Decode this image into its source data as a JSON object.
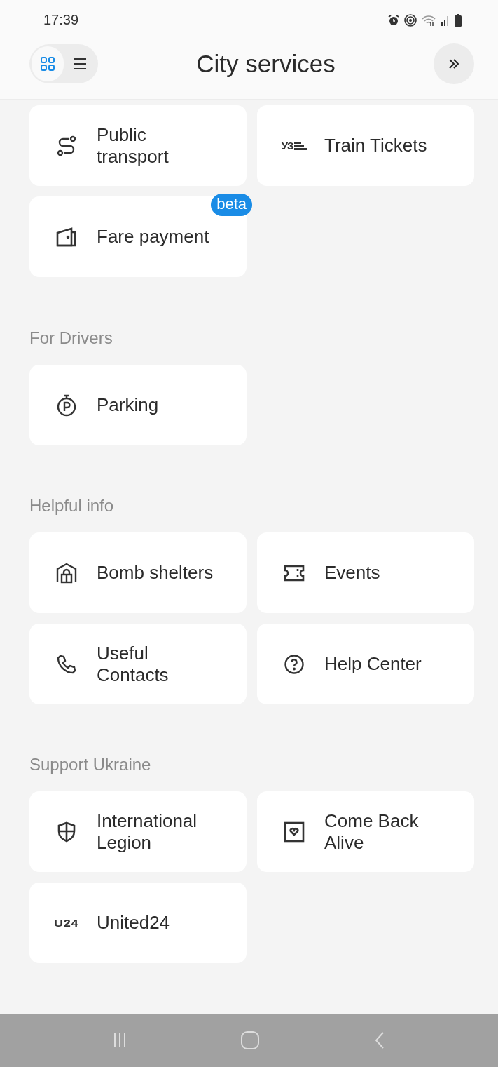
{
  "status_bar": {
    "time": "17:39"
  },
  "header": {
    "title": "City services",
    "view_toggle": [
      {
        "kind": "grid",
        "selected": true
      },
      {
        "kind": "list",
        "selected": false
      }
    ]
  },
  "sections": [
    {
      "items": [
        {
          "label": "Public transport",
          "kind": "route"
        },
        {
          "label": "Train Tickets",
          "kind": "uz",
          "logo_text": "УЗ"
        },
        {
          "label": "Fare payment",
          "kind": "wallet",
          "badge": "beta"
        }
      ]
    },
    {
      "title": "For Drivers",
      "items": [
        {
          "label": "Parking",
          "kind": "parking"
        }
      ]
    },
    {
      "title": "Helpful info",
      "items": [
        {
          "label": "Bomb shelters",
          "kind": "shelter"
        },
        {
          "label": "Events",
          "kind": "ticket"
        },
        {
          "label": "Useful Contacts",
          "kind": "phone"
        },
        {
          "label": "Help Center",
          "kind": "help"
        }
      ]
    },
    {
      "title": "Support Ukraine",
      "items": [
        {
          "label": "International Legion",
          "kind": "shield"
        },
        {
          "label": "Come Back Alive",
          "kind": "heart"
        },
        {
          "label": "United24",
          "kind": "u24",
          "logo_text": "U24"
        }
      ]
    }
  ],
  "nav_bar": [
    {
      "kind": "recents"
    },
    {
      "kind": "home"
    },
    {
      "kind": "back"
    }
  ]
}
